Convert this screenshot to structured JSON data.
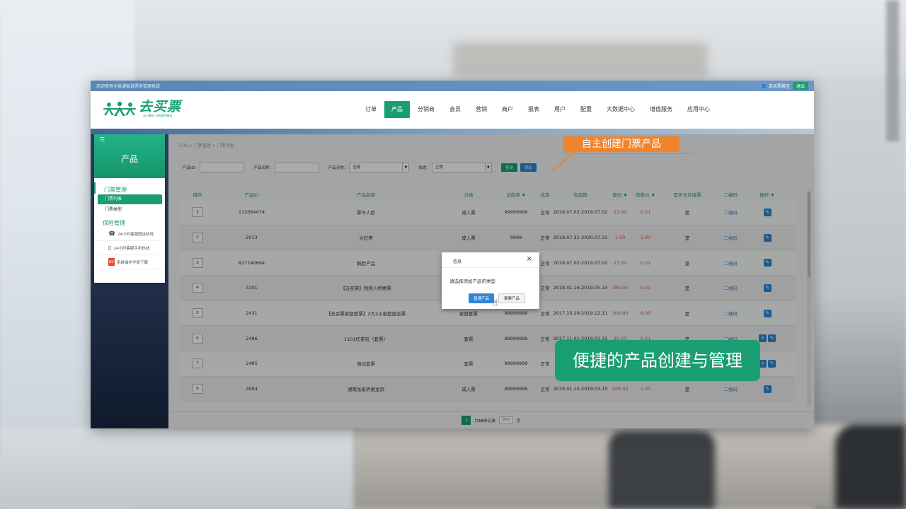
{
  "app": {
    "welcome": "欢迎使用全景通智慧票务管理系统",
    "scenic": "去买票景区",
    "logout": "退出",
    "logo_name": "去买票",
    "logo_slogan": "去心景区 为您提供服务"
  },
  "nav": [
    "订单",
    "产品",
    "分销商",
    "会员",
    "营销",
    "商户",
    "报表",
    "用户",
    "配置",
    "大数据中心",
    "增值服务",
    "应用中心"
  ],
  "nav_active": "产品",
  "sidebar": {
    "title": "产品",
    "group1": "门票管理",
    "item_active": "门票列表",
    "item2": "门票类型",
    "group2": "保险管理",
    "link1": "24小时客服固话热线",
    "link2": "24小时客服手机热线",
    "link3": "系统操作手册下载"
  },
  "breadcrumb": "产品 > 门票管理 > 门票列表",
  "filters": {
    "product_id_label": "产品ID：",
    "product_name_label": "产品名称：",
    "category_label": "产品分类：",
    "category_value": "全部",
    "state_label": "状态：",
    "state_value": "正常",
    "query": "查询",
    "add": "添加"
  },
  "table": {
    "headers": [
      "排序",
      "产品ID",
      "产品名称",
      "分类",
      "总库存 ♦",
      "状态",
      "有效期",
      "原价 ♦",
      "销售价 ♦",
      "是否允许退票",
      "二维码",
      "操作 ♦"
    ],
    "rows": [
      {
        "idx": "1",
        "id": "112064074",
        "name": "票号人脸",
        "cat": "成人票",
        "stock": "99999999",
        "state": "正常",
        "valid": "2018.07.02-2019.07.02",
        "price": "23.00",
        "sale": "0.01",
        "refund": "是",
        "qr": "二维码"
      },
      {
        "idx": "2",
        "id": "2013",
        "name": "大红枣",
        "cat": "成人票",
        "stock": "9999",
        "state": "正常",
        "valid": "2018.07.31-2020.07.31",
        "price": "1.00",
        "sale": "1.00",
        "refund": "是",
        "qr": "二维码"
      },
      {
        "idx": "3",
        "id": "827140664",
        "name": "刷脸产品",
        "cat": "",
        "stock": "",
        "state": "正常",
        "valid": "2018.07.02-2019.07.02",
        "price": "23.00",
        "sale": "0.01",
        "refund": "是",
        "qr": "二维码"
      },
      {
        "idx": "4",
        "id": "3101",
        "name": "【去买票】残疾人特惠票",
        "cat": "",
        "stock": "",
        "state": "正常",
        "valid": "2018.01.16-2019.05.14",
        "price": "380.00",
        "sale": "0.01",
        "refund": "是",
        "qr": "二维码"
      },
      {
        "idx": "5",
        "id": "2431",
        "name": "【去买票家庭套票】2大2小家庭组合票",
        "cat": "家庭套票",
        "stock": "99999999",
        "state": "正常",
        "valid": "2017.10.29-2019.12.11",
        "price": "100.00",
        "sale": "6.00",
        "refund": "是",
        "qr": "二维码"
      },
      {
        "idx": "6",
        "id": "2486",
        "name": "1101红茶包（套票）",
        "cat": "套票",
        "stock": "99999999",
        "state": "正常",
        "valid": "2017.11.01-2019.01.31",
        "price": "20.00",
        "sale": "0.01",
        "refund": "是",
        "qr": "二维码"
      },
      {
        "idx": "7",
        "id": "2485",
        "name": "测试套票",
        "cat": "套票",
        "stock": "99999999",
        "state": "正常",
        "valid": "",
        "price": "",
        "sale": "",
        "refund": "",
        "qr": ""
      },
      {
        "idx": "8",
        "id": "3084",
        "name": "湖南张家界黄龙洞",
        "cat": "成人票",
        "stock": "99999999",
        "state": "正常",
        "valid": "2018.01.15-2019.03.15",
        "price": "199.00",
        "sale": "1.00",
        "refund": "是",
        "qr": "二维码"
      }
    ]
  },
  "pager": {
    "page": "1",
    "total_prefix": "共",
    "total_count": "19",
    "total_suffix": "条记录",
    "goto": "跳到",
    "page_unit": "页"
  },
  "dialog": {
    "title": "信息",
    "close": "×",
    "message": "请选择添加产品的类型",
    "btn1": "普通产品",
    "btn2": "套票产品"
  },
  "callouts": {
    "top": "自主创建门票产品",
    "bottom": "便捷的产品创建与管理"
  },
  "colors": {
    "brand": "#1a9e74",
    "accent_blue": "#2f86d6",
    "price_red": "#e0563f",
    "callout_orange": "#f0832c"
  },
  "icons": {
    "edit": "pencil-icon",
    "add": "plus-icon",
    "menu": "menu-icon",
    "phone": "phone-icon",
    "mobile": "mobile-icon",
    "pdf": "pdf-icon",
    "user": "user-icon",
    "cursor": "hand-cursor-icon"
  }
}
